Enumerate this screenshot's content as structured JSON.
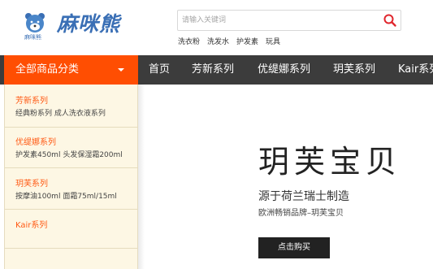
{
  "header": {
    "logo_small_text": "麻咪熊",
    "brand": "麻咪熊",
    "search": {
      "placeholder": "请输入关键词"
    },
    "hot_keywords": [
      "洗衣粉",
      "洗发水",
      "护发素",
      "玩具"
    ]
  },
  "nav": {
    "all_categories": "全部商品分类",
    "items": [
      "首页",
      "芳新系列",
      "优缇娜系列",
      "玥芙系列",
      "Kair系列"
    ]
  },
  "sidebar": {
    "categories": [
      {
        "title": "芳新系列",
        "sub": [
          "经典粉系列",
          "成人洗衣液系列"
        ]
      },
      {
        "title": "优缇娜系列",
        "sub": [
          "护发素450ml",
          "头发保湿霜200ml"
        ]
      },
      {
        "title": "玥芙系列",
        "sub": [
          "按摩油100ml",
          "面霜75ml/15ml"
        ]
      },
      {
        "title": "Kair系列",
        "sub": []
      }
    ]
  },
  "banner": {
    "title": "玥芙宝贝",
    "subtitle": "源于荷兰瑞士制造",
    "tagline": "欧洲畅销品牌–玥芙宝贝",
    "button": "点击购买"
  },
  "colors": {
    "accent": "#ff4e02",
    "nav_bg": "#3c3c3c",
    "sidebar_bg": "#fdf7e4",
    "brand_blue": "#3a6fb5",
    "search_icon": "#e0262d"
  },
  "icons": [
    "bear-logo-icon",
    "search-icon",
    "caret-down-icon"
  ]
}
